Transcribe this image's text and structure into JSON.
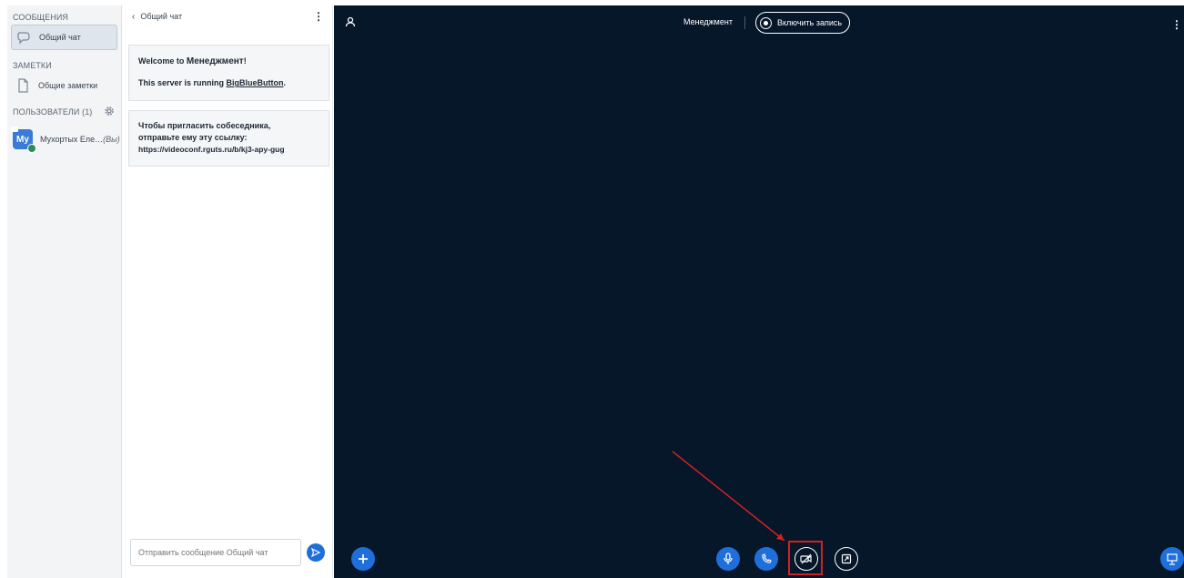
{
  "sidebar": {
    "messages_title": "СООБЩЕНИЯ",
    "public_chat_label": "Общий чат",
    "notes_title": "ЗАМЕТКИ",
    "shared_notes_label": "Общие заметки",
    "users_title": "ПОЛЬЗОВАТЕЛИ (1)",
    "users": [
      {
        "avatar_initials": "My",
        "name": "Мухортых Еле…",
        "role": "(Вы)"
      }
    ]
  },
  "chat": {
    "header_label": "Общий чат",
    "welcome_prefix": "Welcome to ",
    "welcome_name": "Менеджмент",
    "welcome_suffix": "!",
    "server_prefix": "This server is running ",
    "server_link": "BigBlueButton",
    "server_suffix": ".",
    "invite_line1": "Чтобы пригласить собеседника,",
    "invite_line2": "отправьте ему эту ссылку:",
    "invite_link": "https://videoconf.rguts.ru/b/kj3-apy-gug",
    "input_placeholder": "Отправить сообщение Общий чат"
  },
  "stage": {
    "meeting_title": "Менеджмент",
    "record_label": "Включить запись"
  },
  "colors": {
    "stage_bg": "#06172a",
    "accent_blue": "#1e6fd9",
    "highlight_red": "#d32020"
  },
  "icons": {
    "actions": "plus-icon",
    "mute": "microphone-icon",
    "leave_audio": "phone-icon",
    "video": "video-off-icon",
    "screenshare": "screenshare-icon",
    "presentation": "presentation-icon"
  }
}
